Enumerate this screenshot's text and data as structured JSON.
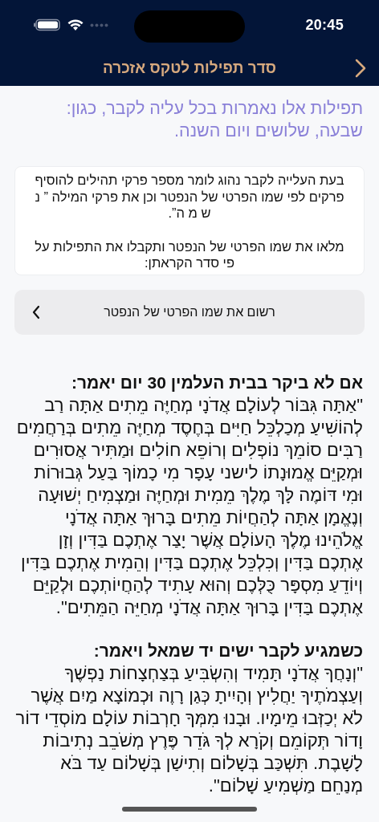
{
  "status_bar": {
    "time": "20:45"
  },
  "header": {
    "title": "סדר תפילות לטקס אזכרה"
  },
  "intro": "תפילות אלו נאמרות בכל עליה לקבר, כגון: שבעה, שלושים ויום השנה.",
  "info_card": {
    "paragraphs": [
      "בעת העלייה לקבר נהוג לומר מספר פרקי תהילים להוסיף פרקים לפי שמו הפרטי של הנפטר וכן את פרקי המילה ” נ ש מ ה”.",
      "מלאו את שמו הפרטי של הנפטר ותקבלו את התפילות על פי סדר הקראתן:"
    ]
  },
  "name_button": {
    "label": "רשום את שמו הפרטי של הנפטר"
  },
  "sections": [
    {
      "heading": "אם לא ביקר בבית העלמין 30 יום יאמר:",
      "text": "\"אַתָּה גִּבּוֹר לְעוֹלָם אֲדֹנָי מְחַיֶּה מֵתִים אַתָּה רַב לְהוֹשִׁיעַ מְכַלְכֵּל חַיִּים בְּחֶסֶד מְחַיֶּה מֵתִים בְּרַחֲמִים רַבִּים סוֹמֵךְ נוֹפְלִים וְרוֹפֵא חוֹלִים וּמַתִּיר אֲסוּרִים וּמְקַיֵּם אֱמוּנָתוֹ לישני עָפָר מִי כָמוֹךָ בַּעַל גְּבוּרוֹת וּמִי דּוֹמֶה לָּךְ מֶלֶךְ מֵמִית וּמְחַיֶּה וּמַצְמִיחַ יְשׁוּעָה וְנֶאֱמָן אַתָּה לְהַחֲיוֹת מֵתִים בָּרוּךְ אַתָּה אֲדֹנָי אֱלֹהֵינוּ מֶלֶךְ הָעוֹלָם אֲשֶׁר יָצַר אֶתְכֶם בַּדִּין וְזָן אֶתְכֶם בַּדִּין וְכִלְכֵּל אֶתְכֶם בַּדִּין וְהֵמִית אֶתְכֶם בַּדִּין וְיוֹדֵעַ מִסְפָּר כֻּלְּכֶם וְהוּא עָתִיד לְהַחֲיוֹתְכֶם וּלְקַיֵּם אֶתְכֶם בַּדִּין בָּרוּךְ אַתָּה אֲדֹנָי מְחַיֵּה הַמֵּתִים\"."
    },
    {
      "heading": "כשמגיע לקבר ישים יד שמאל ויאמר:",
      "text": "\"וְנָחֲךָ אֲדֹנָי תָּמִיד וְהִשְׂבִּיעַ בְּצַחְצָחוֹת נַפְשֶׁךָ וְעַצְמֹתֶיךָ יַחֲלִיץ וְהָיִיתָ כְּגַן רָוֶה וּכְמוֹצָא מַיִם אֲשֶׁר לֹא יְכַזְּבוּ מֵימָיו. וּבָנוּ מִמְּךָ חָרְבוֹת עוֹלָם מוֹסְדֵי דוֹר וָדוֹר תְּקוֹמֵם וְקֹרָא לְךָ גֹּדֵר פֶּרֶץ מְשֹׁבֵב נְתִיבוֹת לָשָׁבֶת. תִּשְׁכַּב בְּשָׁלוֹם וְתִישַׁן בְּשָׁלוֹם עַד בֹּא מְנַחֵם מַשְׁמִיעַ שָׁלוֹם\"."
    }
  ]
}
